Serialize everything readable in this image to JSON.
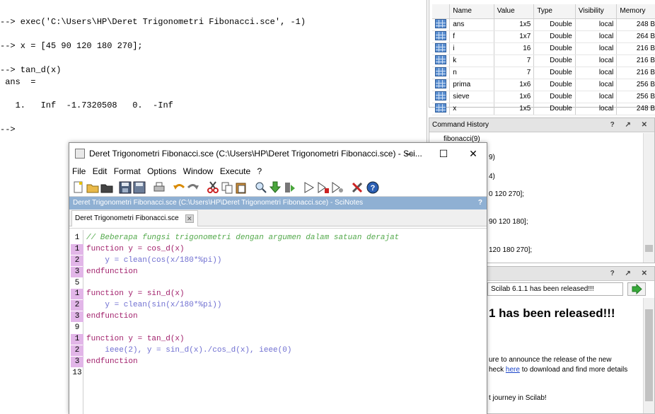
{
  "console": {
    "lines": [
      "--> exec('C:\\Users\\HP\\Deret Trigonometri Fibonacci.sce', -1)",
      "--> x = [45 90 120 180 270];",
      "--> tan_d(x)",
      " ans  =",
      "   1.   Inf  -1.7320508   0.  -Inf",
      "-->"
    ]
  },
  "variable_browser": {
    "columns": [
      "Name",
      "Value",
      "Type",
      "Visibility",
      "Memory"
    ],
    "rows": [
      {
        "name": "ans",
        "value": "1x5",
        "type": "Double",
        "visibility": "local",
        "memory": "248 B"
      },
      {
        "name": "f",
        "value": "1x7",
        "type": "Double",
        "visibility": "local",
        "memory": "264 B"
      },
      {
        "name": "i",
        "value": "16",
        "type": "Double",
        "visibility": "local",
        "memory": "216 B"
      },
      {
        "name": "k",
        "value": "7",
        "type": "Double",
        "visibility": "local",
        "memory": "216 B"
      },
      {
        "name": "n",
        "value": "7",
        "type": "Double",
        "visibility": "local",
        "memory": "216 B"
      },
      {
        "name": "prima",
        "value": "1x6",
        "type": "Double",
        "visibility": "local",
        "memory": "256 B"
      },
      {
        "name": "sieve",
        "value": "1x6",
        "type": "Double",
        "visibility": "local",
        "memory": "256 B"
      },
      {
        "name": "x",
        "value": "1x5",
        "type": "Double",
        "visibility": "local",
        "memory": "248 B"
      }
    ]
  },
  "command_history": {
    "title": "Command History",
    "controls": "? ↗ ✕",
    "visible_fragments": [
      "fibonacci(9)",
      "9)",
      "4)",
      "0 120 270];",
      "90 120 180];",
      "120 180 270];"
    ]
  },
  "news_feed": {
    "controls": "? ↗ ✕",
    "selected_item": "Scilab 6.1.1 has been released!!!",
    "headline_fragment": "1 has been released!!!",
    "para1_line1": "ure to announce the release of the new",
    "para1_line2_pre": "heck ",
    "para1_link": "here",
    "para1_line2_post": " to download and find more details",
    "para2": "t journey in Scilab!"
  },
  "scinotes": {
    "title": "Deret Trigonometri Fibonacci.sce (C:\\Users\\HP\\Deret Trigonometri Fibonacci.sce) - Sci...",
    "menu": [
      "File",
      "Edit",
      "Format",
      "Options",
      "Window",
      "Execute",
      "?"
    ],
    "doc_bar": "Deret Trigonometri Fibonacci.sce (C:\\Users\\HP\\Deret Trigonometri Fibonacci.sce) - SciNotes",
    "doc_bar_help": "?",
    "tab_label": "Deret Trigonometri Fibonacci.sce",
    "gutter": [
      "1",
      "1",
      "2",
      "3",
      "5",
      "1",
      "2",
      "3",
      "9",
      "1",
      "2",
      "3",
      "13"
    ],
    "code": [
      "// Beberapa fungsi trigonometri dengan argumen dalam satuan derajat",
      "function y = cos_d(x)",
      "    y = clean(cos(x/180*%pi))",
      "endfunction",
      "",
      "function y = sin_d(x)",
      "    y = clean(sin(x/180*%pi))",
      "endfunction",
      "",
      "function y = tan_d(x)",
      "    ieee(2), y = sin_d(x)./cos_d(x), ieee(0)",
      "endfunction",
      ""
    ]
  }
}
